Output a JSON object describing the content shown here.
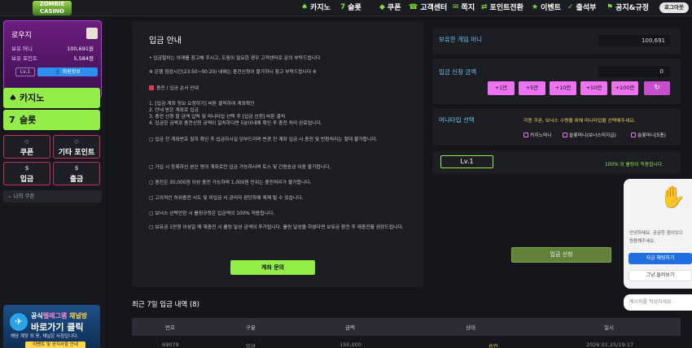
{
  "brand": {
    "logo_text": "ZOMBIE CASINO"
  },
  "nav": [
    {
      "icon": "♠",
      "label": "카지노"
    },
    {
      "icon": "7",
      "label": "슬롯"
    },
    {
      "icon": "◆",
      "label": "쿠폰"
    },
    {
      "icon": "☎",
      "label": "고객센터"
    },
    {
      "icon": "✉",
      "label": "쪽지"
    },
    {
      "icon": "⇄",
      "label": "포인트전환"
    },
    {
      "icon": "★",
      "label": "이벤트"
    },
    {
      "icon": "✓",
      "label": "출석부"
    },
    {
      "icon": "⚑",
      "label": "공지&규정"
    }
  ],
  "login_label": "로그아웃",
  "user": {
    "name": "로우지",
    "money_label": "보유 머니",
    "money": "100,691원",
    "points_label": "보유 포인트",
    "points": "5,584점",
    "level": "Lv.1",
    "mypage": "회원정보"
  },
  "side_games": [
    {
      "icon": "♠",
      "label": "카지노"
    },
    {
      "icon": "7",
      "label": "슬롯"
    }
  ],
  "side_boxes": [
    {
      "label": "쿠폰",
      "icon": "◇"
    },
    {
      "label": "기타 포인트",
      "icon": "◇"
    },
    {
      "label": "입금",
      "icon": "$"
    },
    {
      "label": "출금",
      "icon": "$"
    }
  ],
  "coupon_line": "나의 쿠폰",
  "telegram": {
    "line1a": "공식",
    "line1b": "텔레그램",
    "line1c": "채널방",
    "line2": "바로가기 클릭",
    "line3": "해당 계정 외 옷, 채널은 사칭입니다.",
    "line4": "이벤트 및 공지사항 안내"
  },
  "guide": {
    "title": "입금 안내",
    "lines": [
      "• 입금절차는 아래를 참고해 주시고, 도움이 필요한 경우 고객센터로 문의 부탁드립니다",
      "※ 은행 점검시간(23:50~00:20) 내에는 충전신청이 불가하니 참고 부탁드립니다 ※",
      "충전 / 입금 순서 안내",
      "1. [입금 계좌 정보 요청하기] 버튼 클릭하여 계좌확인",
      "2. 안내 받은 계좌로 입금",
      "3. 충전 신청 할 금액 입력 및 머니타입 선택 후 [입금 신청] 버튼 클릭",
      "4. 입금한 금액과 충전신청 금액이 일치하다면 5분이내에 확인 후 충전 처리 완료됩니다.",
      "입금 전 계좌번호 필히 확인 후 입금하시길 당부드리며 변경 전 계좌 입금 시 충전 및 반환처리는 절대 불가합니다.",
      "가입 시 등록하신 본인 명의 계좌로만 입금 가능하시며 토스 및 간편송금 이용 불가합니다.",
      "충전은 30,000원 이상 충전 가능하며 1,000원 단위는 충전처리가 불가합니다.",
      "고의적인 허위충전 시도 및 미입금 시 관리자 판단하에 제재 될 수 있습니다.",
      "보너스 선택안함 시 롤링규정은 입금액의 100% 적용됩니다.",
      "보유금 1만원 이상일 때 재충전 시 롤링 달성 금액이 추가됩니다. 롤링 달성을 하였다면 보유금 환전 후 재충전을 권장드립니다."
    ],
    "consult_button": "계좌 문의"
  },
  "money_panel": {
    "label": "보유한 게임 머니",
    "value": "100,691"
  },
  "amount_panel": {
    "label": "입금 신청 금액",
    "value": "0",
    "buttons": [
      "+1만",
      "+5만",
      "+10만",
      "+50만",
      "+100만"
    ],
    "reset_icon": "↻"
  },
  "money_type": {
    "label": "머니타입 선택",
    "notice": "각종 쿠폰, 보너스 수령을 위해 머니타입을 선택해주세요.",
    "options": [
      "카지노머니",
      "슬롯머니(보너스미지급)",
      "슬롯머니(5충)"
    ]
  },
  "level_panel": {
    "level": "Lv.1",
    "rolling": "100% 의 롤링이 적용됩니다."
  },
  "deposit_button": "입금 신청",
  "recent": {
    "title": "최근 7일 입금 내역 (8)",
    "headers": [
      "번호",
      "구분",
      "금액",
      "상태",
      "일시"
    ],
    "row": [
      "69079",
      "입금",
      "150,000",
      "승인",
      "2026.01.25/19:17"
    ]
  },
  "chat": {
    "line1": "안녕하세요. 궁금한 점이있으",
    "line2": "원용해주세요.",
    "btn1": "지금 채팅하기",
    "btn2": "그냥 둘러보기",
    "placeholder": "메시지를 작성하세요."
  },
  "colors": {
    "accent_green": "#93ec47",
    "accent_pink": "#ee73f0",
    "label_blue": "#6fc0f0"
  }
}
